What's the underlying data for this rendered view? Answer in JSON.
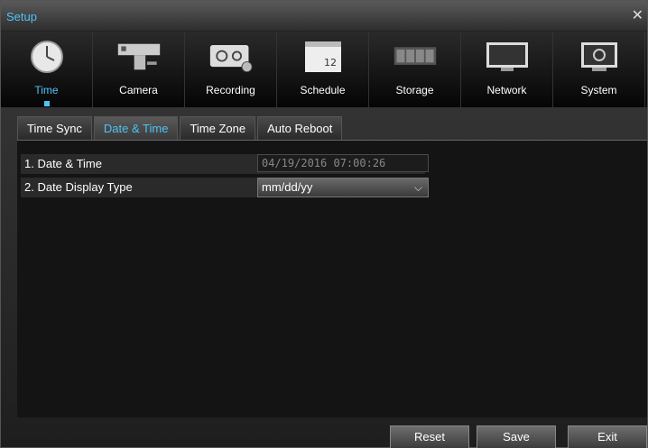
{
  "window": {
    "title": "Setup",
    "close_glyph": "✕"
  },
  "menu": [
    {
      "label": "Time",
      "icon": "clock-icon",
      "active": true
    },
    {
      "label": "Camera",
      "icon": "camera-icon"
    },
    {
      "label": "Recording",
      "icon": "recording-icon"
    },
    {
      "label": "Schedule",
      "icon": "calendar-icon",
      "icon_text": "12"
    },
    {
      "label": "Storage",
      "icon": "storage-icon"
    },
    {
      "label": "Network",
      "icon": "monitor-icon"
    },
    {
      "label": "System",
      "icon": "system-gear-icon"
    }
  ],
  "tabs": [
    {
      "label": "Time Sync"
    },
    {
      "label": "Date & Time",
      "active": true
    },
    {
      "label": "Time Zone"
    },
    {
      "label": "Auto Reboot"
    }
  ],
  "settings": {
    "date_time_label": "1. Date & Time",
    "date_time_value": "04/19/2016 07:00:26",
    "date_display_label": "2. Date Display Type",
    "date_display_value": "mm/dd/yy",
    "chevron": "⌵"
  },
  "buttons": {
    "reset": "Reset",
    "save": "Save",
    "exit": "Exit"
  },
  "colors": {
    "accent": "#4fc3f7",
    "background": "#141414"
  }
}
